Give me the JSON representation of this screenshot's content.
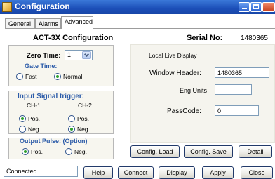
{
  "window": {
    "title": "Configuration"
  },
  "tabs": [
    {
      "label": "General"
    },
    {
      "label": "Alarms"
    },
    {
      "label": "Advanced",
      "selected": true
    }
  ],
  "config": {
    "heading": "ACT-3X Configuration",
    "serial_label": "Serial No:",
    "serial_value": "1480365"
  },
  "zero_time": {
    "label": "Zero Time:",
    "value": "1"
  },
  "gate_time": {
    "label": "Gate Time:",
    "fast": "Fast",
    "normal": "Normal",
    "selected": "Normal"
  },
  "input_signal": {
    "label": "Input Signal trigger:",
    "ch1": {
      "label": "CH-1",
      "pos": "Pos.",
      "neg": "Neg.",
      "selected": "Pos."
    },
    "ch2": {
      "label": "CH-2",
      "pos": "Pos.",
      "neg": "Neg.",
      "selected": "Neg."
    }
  },
  "output_pulse": {
    "label": "Output Pulse: (Option)",
    "pos": "Pos.",
    "neg": "Neg.",
    "selected": "Pos."
  },
  "live_display": {
    "title": "Local Live Display",
    "window_header_label": "Window Header:",
    "window_header_value": "1480365",
    "eng_units_label": "Eng Units",
    "eng_units_value": ""
  },
  "passcode": {
    "label": "PassCode:",
    "value": "0"
  },
  "panel_buttons": {
    "config_load": "Config. Load",
    "config_save": "Config. Save",
    "detail": "Detail"
  },
  "footer": {
    "status": "Connected",
    "help": "Help",
    "connect": "Connect",
    "display": "Display",
    "apply": "Apply",
    "close": "Close"
  },
  "colors": {
    "titlebar": "#1c4fb8",
    "group_label": "#2a5aa8",
    "group_bg": "#f7f6ef",
    "radio_selected": "#2ea02e"
  }
}
